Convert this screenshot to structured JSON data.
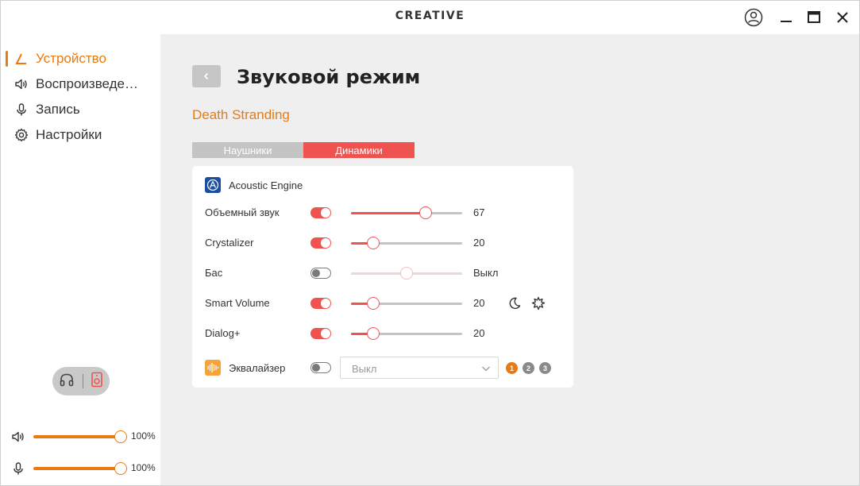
{
  "app": {
    "brand": "CREATIVE"
  },
  "sidebar": {
    "items": [
      {
        "label": "Устройство",
        "icon": "device-icon",
        "active": true
      },
      {
        "label": "Воспроизведение",
        "icon": "speaker-icon",
        "active": false
      },
      {
        "label": "Запись",
        "icon": "microphone-icon",
        "active": false
      },
      {
        "label": "Настройки",
        "icon": "gear-icon",
        "active": false
      }
    ],
    "output_switch": {
      "left_icon": "headphones-icon",
      "right_icon": "speaker-device-icon"
    },
    "playback_volume": {
      "value": 100,
      "label": "100%",
      "icon": "speaker-icon"
    },
    "mic_volume": {
      "value": 100,
      "label": "100%",
      "icon": "microphone-icon"
    }
  },
  "main": {
    "title": "Звуковой режим",
    "profile": "Death Stranding",
    "tabs": [
      {
        "label": "Наушники",
        "active": false
      },
      {
        "label": "Динамики",
        "active": true
      }
    ],
    "acoustic_engine": {
      "title": "Acoustic Engine",
      "rows": [
        {
          "label": "Объемный звук",
          "enabled": true,
          "value": 67,
          "display": "67"
        },
        {
          "label": "Crystalizer",
          "enabled": true,
          "value": 20,
          "display": "20"
        },
        {
          "label": "Бас",
          "enabled": false,
          "value": 50,
          "display": "Выкл"
        },
        {
          "label": "Smart Volume",
          "enabled": true,
          "value": 20,
          "display": "20"
        },
        {
          "label": "Dialog+",
          "enabled": true,
          "value": 20,
          "display": "20"
        }
      ]
    },
    "equalizer": {
      "label": "Эквалайзер",
      "enabled": false,
      "selected": "Выкл",
      "presets": [
        "1",
        "2",
        "3"
      ],
      "active_preset": "1"
    }
  },
  "colors": {
    "accent": "#e87a10",
    "slider": "#ef5350",
    "panel_bg": "#efefef"
  }
}
